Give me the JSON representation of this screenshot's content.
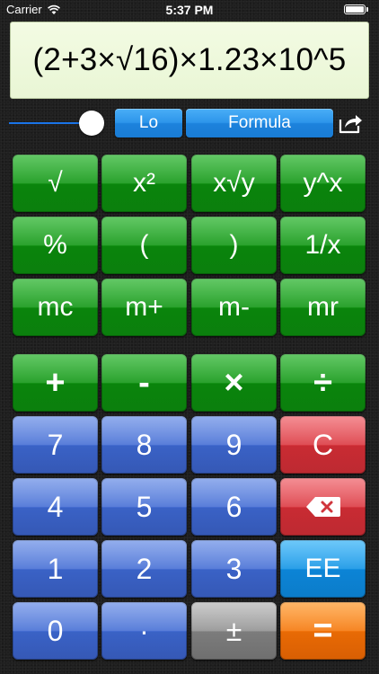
{
  "status_bar": {
    "carrier": "Carrier",
    "time": "5:37 PM"
  },
  "display": {
    "expression": "(2+3×√16)×1.23×10^5"
  },
  "controls": {
    "precision_slider_level": 1.0,
    "lo_label": "Lo",
    "formula_label": "Formula",
    "share_icon": "share-icon"
  },
  "keypad": {
    "function_rows": [
      [
        "√",
        "x²",
        "x√y",
        "y^x"
      ],
      [
        "%",
        "(",
        ")",
        "1/x"
      ],
      [
        "mc",
        "m+",
        "m-",
        "mr"
      ]
    ],
    "operators": [
      "+",
      "-",
      "×",
      "÷"
    ],
    "digits_row1": [
      "7",
      "8",
      "9"
    ],
    "clear_label": "C",
    "digits_row2": [
      "4",
      "5",
      "6"
    ],
    "backspace_icon": "backspace-icon",
    "digits_row3": [
      "1",
      "2",
      "3"
    ],
    "ee_label": "EE",
    "zero_label": "0",
    "decimal_label": "·",
    "sign_label": "±",
    "equals_label": "="
  },
  "colors": {
    "function_keys": "#18991b",
    "number_keys": "#4b73d6",
    "clear_key": "#dc3f47",
    "ee_key": "#1997e6",
    "sign_key": "#959595",
    "equals_key": "#f57b12",
    "display_background": "#eef8dc",
    "pill_buttons": "#2c95ea"
  }
}
